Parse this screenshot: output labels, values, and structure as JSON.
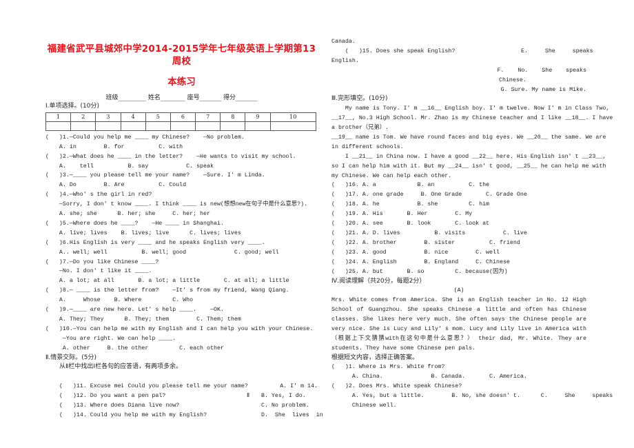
{
  "title": {
    "line1": "福建省武平县城郊中学2014-2015学年七年级英语上学期第13周校",
    "line2": "本练习"
  },
  "info_line": "班级_________  姓名________  座号_______  得分_______",
  "section1": {
    "heading": "Ⅰ.单项选择。(10分)",
    "table_headers": [
      "1",
      "2",
      "3",
      "4",
      "5",
      "6",
      "7",
      "8",
      "9",
      "10"
    ],
    "lines": [
      "(   )1.—Could you help me ____ my Chinese?    —No problem.",
      "    A. in        B. for          C. with",
      "(   )2.—What does he ____ in the letter?    —He wants to visit my school.",
      "    A.    tell          B. say           C. speak",
      "(   )3.—____ you please tell me your name?    —Sure. I' m Linda.",
      "    A. Do        B. Are          C. Could",
      "(   )4.—Who' s the girl in red?",
      "    —Sorry, I don' t know ____. I think ____ is new(想想new在句子中是什么意思?).",
      "    A. she; she      B. her; she     C. her; her",
      "(   )5.—Where does he ____?    —He ____ in Shanghai.",
      "    A. live; lives    B. lives; live      C. lives; lives",
      "(   )6.His English is very ____ and he speaks English very ____.",
      "    A.. well; well          B. well; good              C. good; well",
      "(   )7.—Do you like Chinese ____?",
      "    —No. I don' t like it ____.",
      "    A. a lot; at all       B. a lot; a little       C. at all; a little",
      "",
      "(   )8.— ____ is the letter from?    —It' s from my friend, Wang Qiang.",
      "    A.     Whose    B. Where         C. Who",
      "(   )9.—____ are new here. Let' s help ____.    —OK.",
      "    A. They; They      B. They; them        C. Them; them",
      "(   )10.—You can help me with my English and I can help you with your Chinese.",
      "     —You are right. We can help ____.",
      "     A. other     B. the other         C. each other"
    ]
  },
  "section2": {
    "heading": "Ⅱ.情景交际。(5分)",
    "instruction": "从Ⅱ栏中找出Ⅰ栏各句的应答语，有两项多余。",
    "col1_label": "Ⅰ",
    "col2_label": "Ⅱ",
    "questions": [
      {
        "q": "(   )11. Excuse me. Could you please tell me your name?",
        "a": "A. I' m 14."
      },
      {
        "q": "(   )12. Do you want a pen pal?",
        "a": "B. Yes, I do."
      },
      {
        "q": "(   )13. Where does Diana live now?",
        "a": "C. No problem."
      },
      {
        "q": "(   )14. Could you help me with my English?",
        "a": "D.  She  lives  in"
      }
    ],
    "continuation": "Canada.",
    "q15": "(   )15. Does she speak English?",
    "optE": "E.     She     speaks",
    "optE_cont": "English.",
    "optF": "F.    No.    She    speaks",
    "optF_cont": "Chinese.",
    "optG": "G. Sure. My name is Mike."
  },
  "section3": {
    "heading": "Ⅲ.完形填空。(10分)",
    "passage": [
      "    My name is Tony. I' m __16__ English boy. I' m twelve. Now I' m in Class Two,",
      "__17__, No.3 High School. Mr. Zhao is my Chinese teacher and I like __18__. I have",
      "a brother（兄弟）.",
      "__19__ name is Tom. We have round faces and big eyes. We __20__ the same. We are",
      "in different schools.",
      "    I __21__ in China now. I have a good __22__ here. His English isn' t __23__,",
      "so I can help him with it. But my __24__ isn' t good, __25__ he can help me with",
      "my Chinese. We can help each other."
    ],
    "options": [
      "(   )16. A. a            B. an          C. the",
      "(   )17. A. one grade     B. One Grade       C. Grade One",
      "(   )18. A. he           B. she         C. him",
      "(   )19. A. His       B. Her        C. My",
      "(   )20. A. see       B. look       C. look at",
      "(   )21. A. D. lives          B. visits           C. live",
      "(   )22. A. brother        B. sister          C. friend",
      "(   )23. A. good           B. nice        C. well",
      "(   )24. A. English        B. England     C. Chinese",
      "(   )25. A. but       B. so         C. because(因为)"
    ]
  },
  "section4": {
    "heading": "Ⅳ.阅读理解（共20分，每题2分）",
    "subheading": "(A)",
    "passage": "    Mrs. White comes from America. She is an English teacher in No. 12 High School of Guangzhou. She speaks Chinese a little and often has Chinese classes. She likes here very much. She often says the Chinese people are very nice. She is Lucy and Lily' s mom. Lucy and Lily live in America with（根据上下文猜猜with在这句中是什么意思？） their dad, Mr. White. They are students. They have some Chinese pen pals.",
    "instruction": "根据短文内容，选择正确答案。",
    "questions": [
      "(   )1. Where is Mrs. White from?",
      "      A. China.              B. Canada.       C. America.",
      "(   )2. Does Mrs. White speak Chinese?",
      "      A. Yes, but a little.        B. No, she doesn' t.      C.     She     speaks",
      "      Chinese well."
    ]
  }
}
